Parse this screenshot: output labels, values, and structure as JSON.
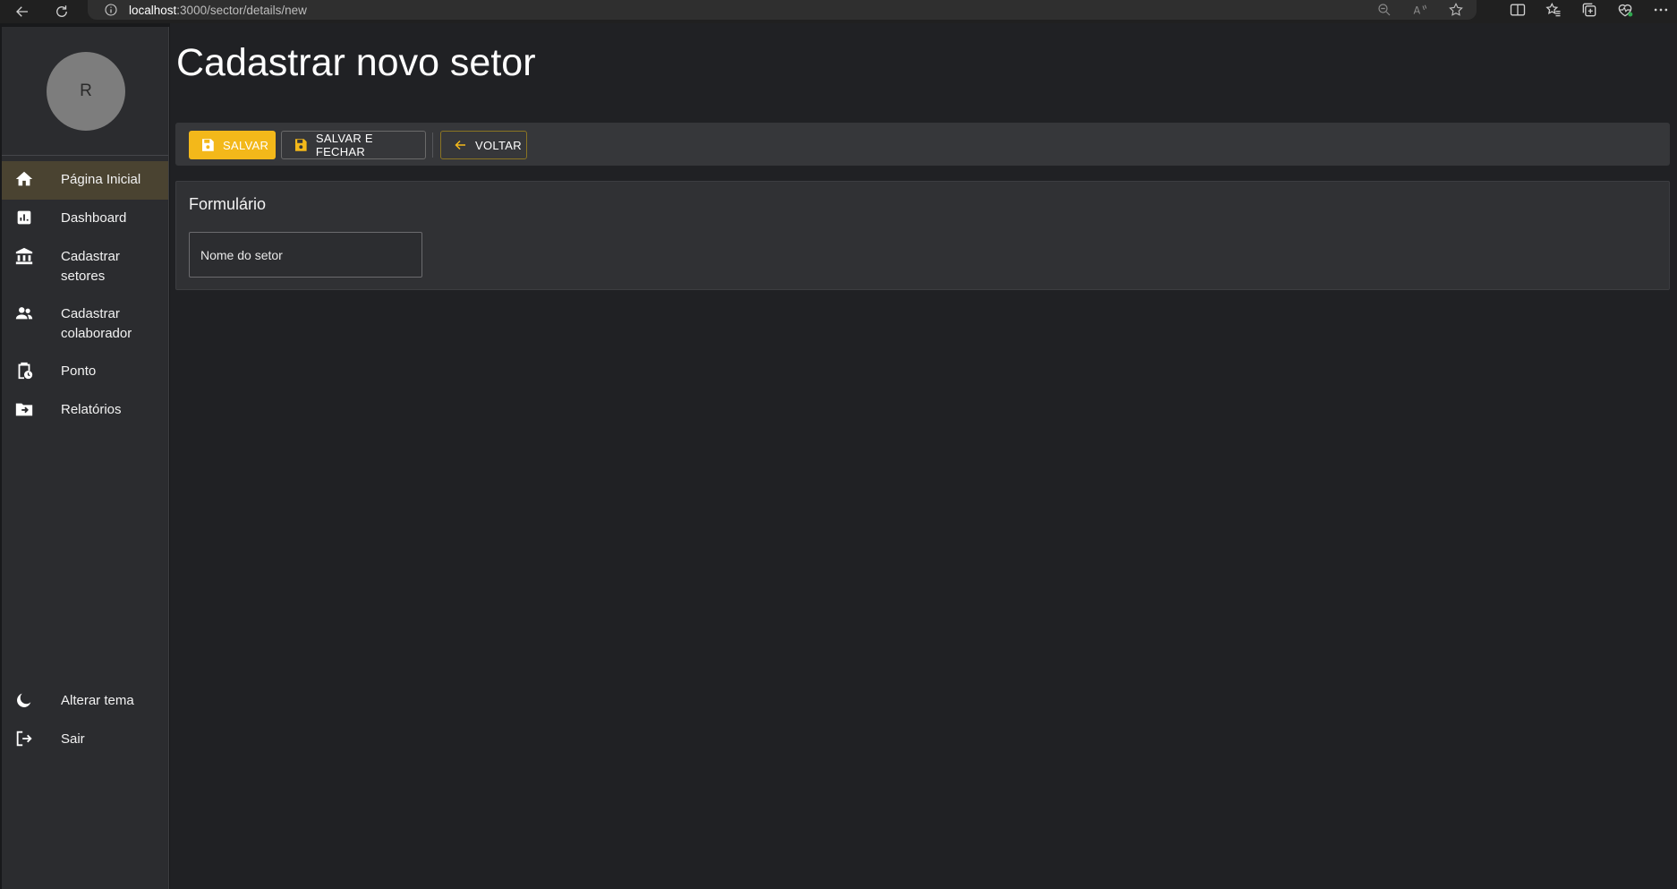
{
  "browser": {
    "url_host": "localhost",
    "url_path": ":3000/sector/details/new"
  },
  "sidebar": {
    "avatar_initial": "R",
    "items": [
      {
        "label": "Página Inicial",
        "icon": "home-icon",
        "active": true
      },
      {
        "label": "Dashboard",
        "icon": "dashboard-chart-icon",
        "active": false
      },
      {
        "label": "Cadastrar setores",
        "icon": "bank-icon",
        "active": false
      },
      {
        "label": "Cadastrar colaborador",
        "icon": "people-icon",
        "active": false
      },
      {
        "label": "Ponto",
        "icon": "clipboard-clock-icon",
        "active": false
      },
      {
        "label": "Relatórios",
        "icon": "folder-arrow-icon",
        "active": false
      }
    ],
    "bottom_items": [
      {
        "label": "Alterar tema",
        "icon": "moon-icon"
      },
      {
        "label": "Sair",
        "icon": "logout-icon"
      }
    ]
  },
  "main": {
    "title": "Cadastrar novo setor",
    "toolbar": {
      "save_label": "SALVAR",
      "save_close_label": "SALVAR E FECHAR",
      "back_label": "VOLTAR"
    },
    "form": {
      "title": "Formulário",
      "sector_name_placeholder": "Nome do setor",
      "sector_name_value": ""
    }
  },
  "colors": {
    "accent": "#f3b81a",
    "active_item_bg": "#4a4331",
    "background": "#202124"
  }
}
